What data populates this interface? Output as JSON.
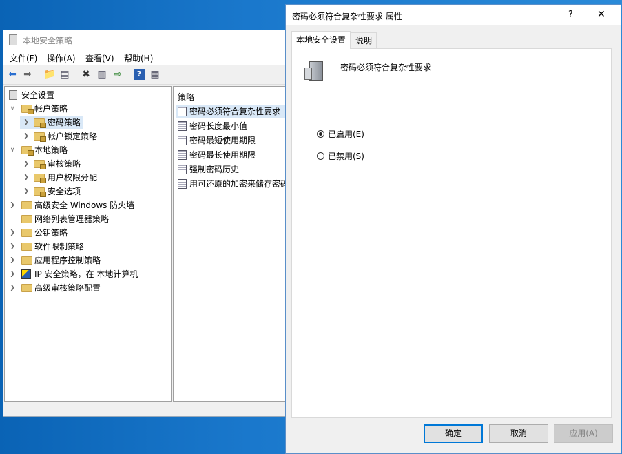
{
  "mmc": {
    "title": "本地安全策略",
    "menu": [
      "文件(F)",
      "操作(A)",
      "查看(V)",
      "帮助(H)"
    ],
    "tree": [
      {
        "label": "安全设置",
        "level": 0,
        "arrow": ""
      },
      {
        "label": "帐户策略",
        "level": 1,
        "arrow": "v"
      },
      {
        "label": "密码策略",
        "level": 2,
        "arrow": ">"
      },
      {
        "label": "帐户锁定策略",
        "level": 2,
        "arrow": ">"
      },
      {
        "label": "本地策略",
        "level": 1,
        "arrow": "v"
      },
      {
        "label": "审核策略",
        "level": 2,
        "arrow": ">"
      },
      {
        "label": "用户权限分配",
        "level": 2,
        "arrow": ">"
      },
      {
        "label": "安全选项",
        "level": 2,
        "arrow": ">"
      },
      {
        "label": "高级安全 Windows 防火墙",
        "level": 1,
        "arrow": ">"
      },
      {
        "label": "网络列表管理器策略",
        "level": 1,
        "arrow": ""
      },
      {
        "label": "公钥策略",
        "level": 1,
        "arrow": ">"
      },
      {
        "label": "软件限制策略",
        "level": 1,
        "arrow": ">"
      },
      {
        "label": "应用程序控制策略",
        "level": 1,
        "arrow": ">"
      },
      {
        "label": "IP 安全策略，在 本地计算机",
        "level": 1,
        "arrow": ">"
      },
      {
        "label": "高级审核策略配置",
        "level": 1,
        "arrow": ">"
      }
    ],
    "list_header": "策略",
    "policies": [
      "密码必须符合复杂性要求",
      "密码长度最小值",
      "密码最短使用期限",
      "密码最长使用期限",
      "强制密码历史",
      "用可还原的加密来储存密码"
    ]
  },
  "dialog": {
    "title": "密码必须符合复杂性要求 属性",
    "help_glyph": "?",
    "close_glyph": "✕",
    "tabs": [
      "本地安全设置",
      "说明"
    ],
    "policy_name": "密码必须符合复杂性要求",
    "options": [
      {
        "label": "已启用(E)",
        "checked": true
      },
      {
        "label": "已禁用(S)",
        "checked": false
      }
    ],
    "buttons": {
      "ok": "确定",
      "cancel": "取消",
      "apply": "应用(A)"
    }
  }
}
